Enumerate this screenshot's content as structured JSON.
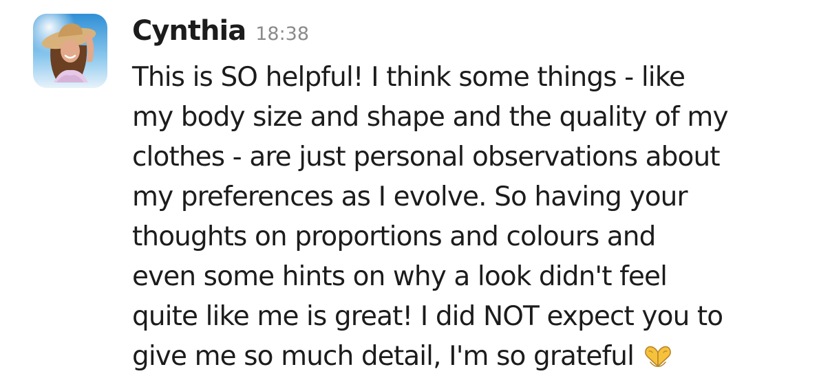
{
  "message": {
    "sender": "Cynthia",
    "timestamp": "18:38",
    "lines": [
      "This is SO helpful! I think some things - like",
      "my body size and shape and the quality of my",
      "clothes - are just personal observations about",
      "my preferences as I evolve. So having your",
      "thoughts on proportions and colours and",
      "even some hints on why a look didn't feel",
      "quite like me is great! I did NOT expect you to",
      "give me so much detail, I'm so grateful"
    ],
    "trailing_emoji": "heart-hands-icon"
  },
  "colors": {
    "text": "#1d1c1d",
    "timestamp": "#8a8a8d",
    "emoji": "#f7c23b"
  }
}
